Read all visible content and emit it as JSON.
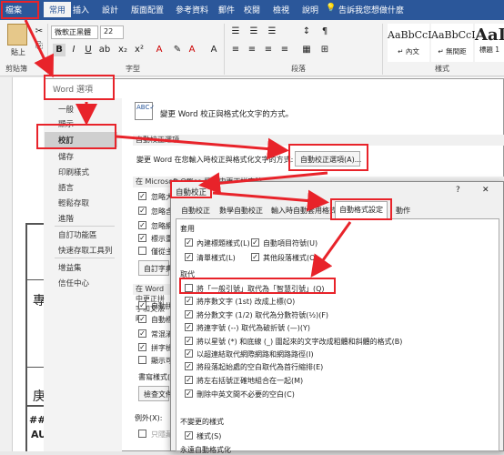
{
  "ribbon": {
    "tabs": [
      "檔案",
      "常用",
      "插入",
      "設計",
      "版面配置",
      "參考資料",
      "郵件",
      "校閱",
      "檢視",
      "說明"
    ],
    "tell_me": "告訴我您想做什麼",
    "paste_label": "貼上",
    "clipboard_group": "剪貼簿",
    "font_name": "微軟正黑體",
    "font_size": "22",
    "font_group": "字型",
    "paragraph_group": "段落",
    "styles_group": "樣式",
    "styles": [
      {
        "sample": "AaBbCcI",
        "name": "↵ 內文"
      },
      {
        "sample": "AaBbCcI",
        "name": "↵ 無間距"
      },
      {
        "sample": "AaI",
        "name": "標題 1"
      }
    ]
  },
  "word_options": {
    "title": "Word 選項",
    "nav": [
      "一般",
      "顯示",
      "校訂",
      "儲存",
      "印刷樣式",
      "語言",
      "輕鬆存取",
      "進階",
      "自訂功能區",
      "快速存取工具列",
      "增益集",
      "信任中心"
    ],
    "header_text": "變更 Word 校正與格式化文字的方式。",
    "autocorrect_section": "自動校正選項",
    "autocorrect_desc": "變更 Word 在您輸入時校正與格式化文字的方式:",
    "autocorrect_button": "自動校正選項(A)...",
    "office_section": "在 Microsoft Office 程式中更正拼字時",
    "office_items": [
      "忽略大寫字",
      "忽略含有數字的字",
      "忽略網際網路和檔案位址",
      "標示重複的字",
      "僅從主要字典建議"
    ],
    "custom_dict_button": "自訂字典",
    "word_section": "在 Word 中更正拼字和文法時",
    "word_items": [
      "自動拼字檢查",
      "自動標記文法錯誤",
      "常混淆的字",
      "拼字檢查時一併檢查文法",
      "顯示可讀性統計資料"
    ],
    "writing_style_label": "書寫樣式(W):",
    "check_document_button": "檢查文件(K)",
    "exceptions_label": "例外(X):",
    "exceptions_item": "只隱藏此文件中的拼字錯誤"
  },
  "autocorrect_dialog": {
    "title": "自動校正",
    "help": "?",
    "close": "✕",
    "tabs": [
      "自動校正",
      "數學自動校正",
      "輸入時自動套用格式",
      "自動格式設定",
      "動作"
    ],
    "active_tab": 3,
    "apply_section": "套用",
    "apply_items": [
      {
        "label": "內建標題樣式(L)",
        "checked": true
      },
      {
        "label": "自動項目符號(U)",
        "checked": true
      },
      {
        "label": "清單樣式(L)",
        "checked": true
      },
      {
        "label": "其他段落樣式(O)",
        "checked": true
      }
    ],
    "replace_section": "取代",
    "replace_items": [
      {
        "label": "將「一般引號」取代為「智慧引號」(Q)",
        "checked": false
      },
      {
        "label": "將序數文字 (1st) 改成上標(O)",
        "checked": true
      },
      {
        "label": "將分數文字 (1/2) 取代為分數符號(½)(F)",
        "checked": true
      },
      {
        "label": "將連字號 (--) 取代為破折號 (—)(Y)",
        "checked": true
      },
      {
        "label": "將以星號 (*) 和底線 (_) 圍起來的文字改成粗體和斜體的格式(B)",
        "checked": true
      },
      {
        "label": "以超連結取代網際網路和網路路徑(I)",
        "checked": true
      },
      {
        "label": "將段落起始處的空白取代為首行縮排(E)",
        "checked": true
      },
      {
        "label": "將左右括號正確地組合在一起(M)",
        "checked": true
      },
      {
        "label": "刪除中英文間不必要的空白(C)",
        "checked": true
      }
    ],
    "preserve_section": "不變更的樣式",
    "preserve_items": [
      {
        "label": "樣式(S)",
        "checked": true
      }
    ],
    "plain_text_section": "永遠自動格式化"
  },
  "highlight_color": "#e8232a",
  "accent_color": "#2b579a"
}
